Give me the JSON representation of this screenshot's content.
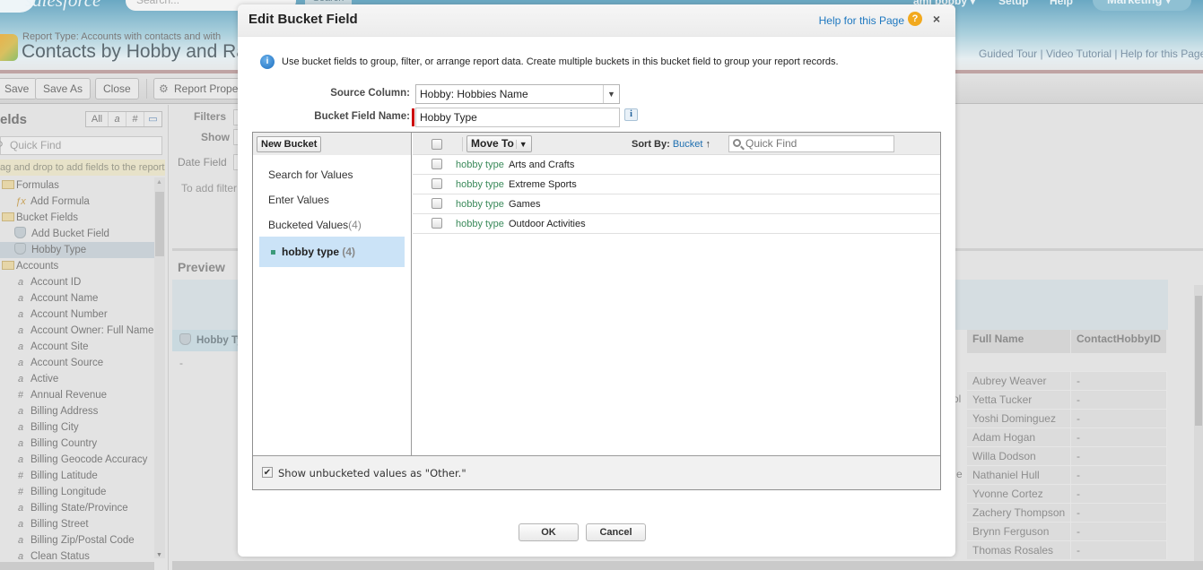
{
  "header": {
    "logo_text": "salesforce",
    "search_placeholder": "Search...",
    "search_button": "Search",
    "user_menu": "ami bobby ▾",
    "setup": "Setup",
    "help": "Help",
    "app_menu": "Marketing ▾"
  },
  "report": {
    "type_label": "Report Type: Accounts with contacts and with",
    "title": "Contacts by Hobby and Ra",
    "help_links": "Guided Tour | Video Tutorial | Help for this Page"
  },
  "toolbar": {
    "save": "Save",
    "save_as": "Save As",
    "close": "Close",
    "report_properties": "Report Proper"
  },
  "sidebar": {
    "title": "elds",
    "filter_buttons": [
      "All",
      "a",
      "#",
      "▭"
    ],
    "quick_find_placeholder": "Quick Find",
    "hint": "ag and drop to add fields to the report.",
    "tree": [
      {
        "type": "folder",
        "label": "Formulas"
      },
      {
        "type": "formula",
        "label": "Add Formula"
      },
      {
        "type": "folder",
        "label": "Bucket Fields"
      },
      {
        "type": "bucket-add",
        "label": "Add Bucket Field"
      },
      {
        "type": "bucket",
        "label": "Hobby Type",
        "selected": true
      },
      {
        "type": "folder",
        "label": "Accounts"
      },
      {
        "type": "text",
        "label": "Account ID"
      },
      {
        "type": "text",
        "label": "Account Name"
      },
      {
        "type": "text",
        "label": "Account Number"
      },
      {
        "type": "text",
        "label": "Account Owner: Full Name"
      },
      {
        "type": "text",
        "label": "Account Site"
      },
      {
        "type": "text",
        "label": "Account Source"
      },
      {
        "type": "text",
        "label": "Active"
      },
      {
        "type": "number",
        "label": "Annual Revenue"
      },
      {
        "type": "text",
        "label": "Billing Address"
      },
      {
        "type": "text",
        "label": "Billing City"
      },
      {
        "type": "text",
        "label": "Billing Country"
      },
      {
        "type": "text",
        "label": "Billing Geocode Accuracy"
      },
      {
        "type": "number",
        "label": "Billing Latitude"
      },
      {
        "type": "number",
        "label": "Billing Longitude"
      },
      {
        "type": "text",
        "label": "Billing State/Province"
      },
      {
        "type": "text",
        "label": "Billing Street"
      },
      {
        "type": "text",
        "label": "Billing Zip/Postal Code"
      },
      {
        "type": "text",
        "label": "Clean Status"
      }
    ]
  },
  "filters": {
    "filters_label": "Filters",
    "show_label": "Show",
    "date_field_label": "Date Field",
    "hint": "To add filter"
  },
  "preview": {
    "title": "Preview",
    "group_header": "Hobby Ty",
    "group_value": "-",
    "columns": [
      "Full Name",
      "ContactHobbyID"
    ],
    "rows": [
      [
        "Aubrey Weaver",
        "-"
      ],
      [
        "Yetta Tucker",
        "-"
      ],
      [
        "Yoshi Dominguez",
        "-"
      ],
      [
        "Adam Hogan",
        "-"
      ],
      [
        "Willa Dodson",
        "-"
      ],
      [
        "Nathaniel Hull",
        "-"
      ],
      [
        "Yvonne Cortez",
        "-"
      ],
      [
        "Zachery Thompson",
        "-"
      ],
      [
        "Brynn Ferguson",
        "-"
      ],
      [
        "Thomas Rosales",
        "-"
      ]
    ],
    "left_fragments": {
      "row2": "ol",
      "row6": "e"
    }
  },
  "modal": {
    "title": "Edit Bucket Field",
    "help_link": "Help for this Page",
    "close": "×",
    "info_text": "Use bucket fields to group, filter, or arrange report data. Create multiple buckets in this bucket field to group your report records.",
    "source_column_label": "Source Column:",
    "source_column_value": "Hobby: Hobbies Name",
    "bucket_field_name_label": "Bucket Field Name:",
    "bucket_field_name_value": "Hobby Type",
    "new_bucket": "New Bucket",
    "search_for_values": "Search for Values",
    "enter_values": "Enter Values",
    "bucketed_values": "Bucketed Values",
    "bucketed_count": "(4)",
    "bucket": {
      "name": "hobby type",
      "count": "(4)",
      "color": "#3b9a7a"
    },
    "move_to": "Move To",
    "sort_by_label": "Sort By:",
    "sort_by_value": "Bucket",
    "sort_arrow": "↑",
    "quick_find_placeholder": "Quick Find",
    "values": [
      {
        "bucket": "hobby type",
        "value": "Arts and Crafts",
        "checked": false
      },
      {
        "bucket": "hobby type",
        "value": "Extreme Sports",
        "checked": false
      },
      {
        "bucket": "hobby type",
        "value": "Games",
        "checked": false
      },
      {
        "bucket": "hobby type",
        "value": "Outdoor Activities",
        "checked": false
      }
    ],
    "show_unbucketed_label": "Show unbucketed values as \"Other.\"",
    "show_unbucketed_checked": true,
    "ok": "OK",
    "cancel": "Cancel"
  },
  "colors": {
    "link_blue": "#1e78c0",
    "help_orange": "#f2a91e",
    "bucket_tag_green": "#3a8a5a",
    "selected_bucket_bg": "#cbe3f7",
    "required_red": "#cc0000"
  }
}
